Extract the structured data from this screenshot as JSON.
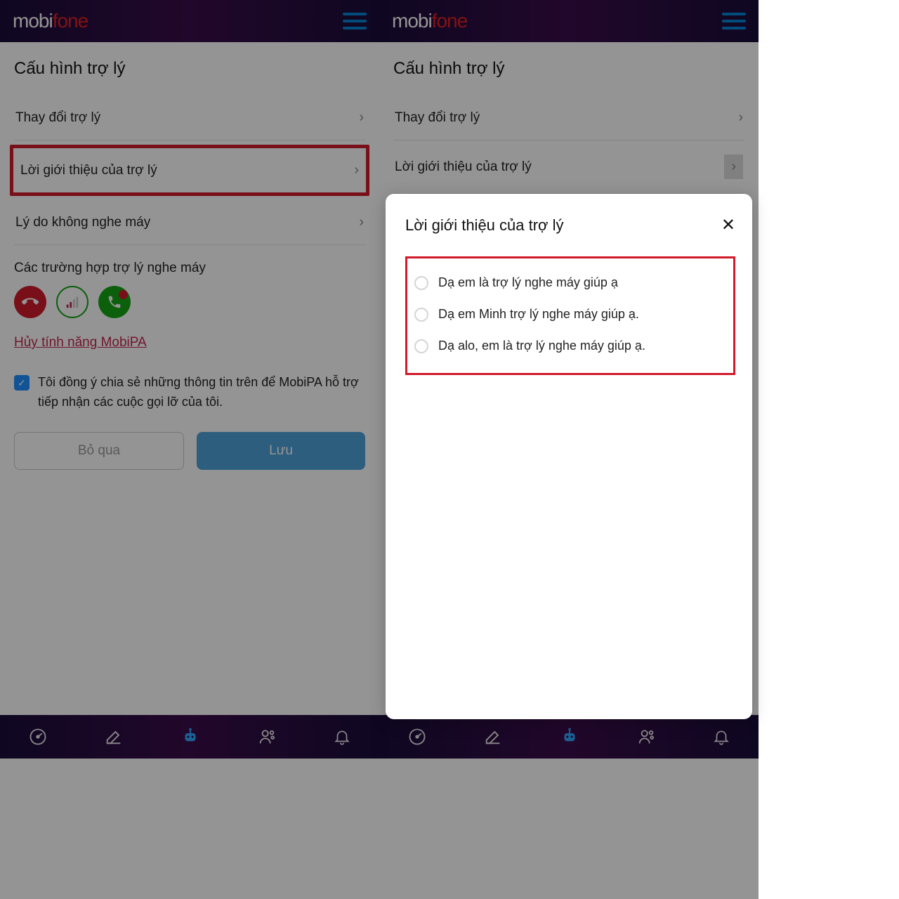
{
  "logo": {
    "left": "mobi",
    "right": "fone"
  },
  "page_title": "Cấu hình trợ lý",
  "rows": {
    "change": "Thay đổi trợ lý",
    "intro": "Lời giới thiệu của trợ lý",
    "reason": "Lý do không nghe máy"
  },
  "section_cases": "Các trường hợp trợ lý nghe máy",
  "cancel_link": "Hủy tính năng MobiPA",
  "consent_text": "Tôi đồng ý chia sẻ những thông tin trên để MobiPA hỗ trợ tiếp nhận các cuộc gọi lỡ của tôi.",
  "btn_skip": "Bỏ qua",
  "btn_save": "Lưu",
  "modal": {
    "title": "Lời giới thiệu của trợ lý",
    "opts": [
      "Dạ em là trợ lý nghe máy giúp ạ",
      "Dạ em Minh trợ lý nghe máy giúp ạ.",
      "Dạ alo, em là trợ lý nghe máy giúp ạ."
    ]
  }
}
